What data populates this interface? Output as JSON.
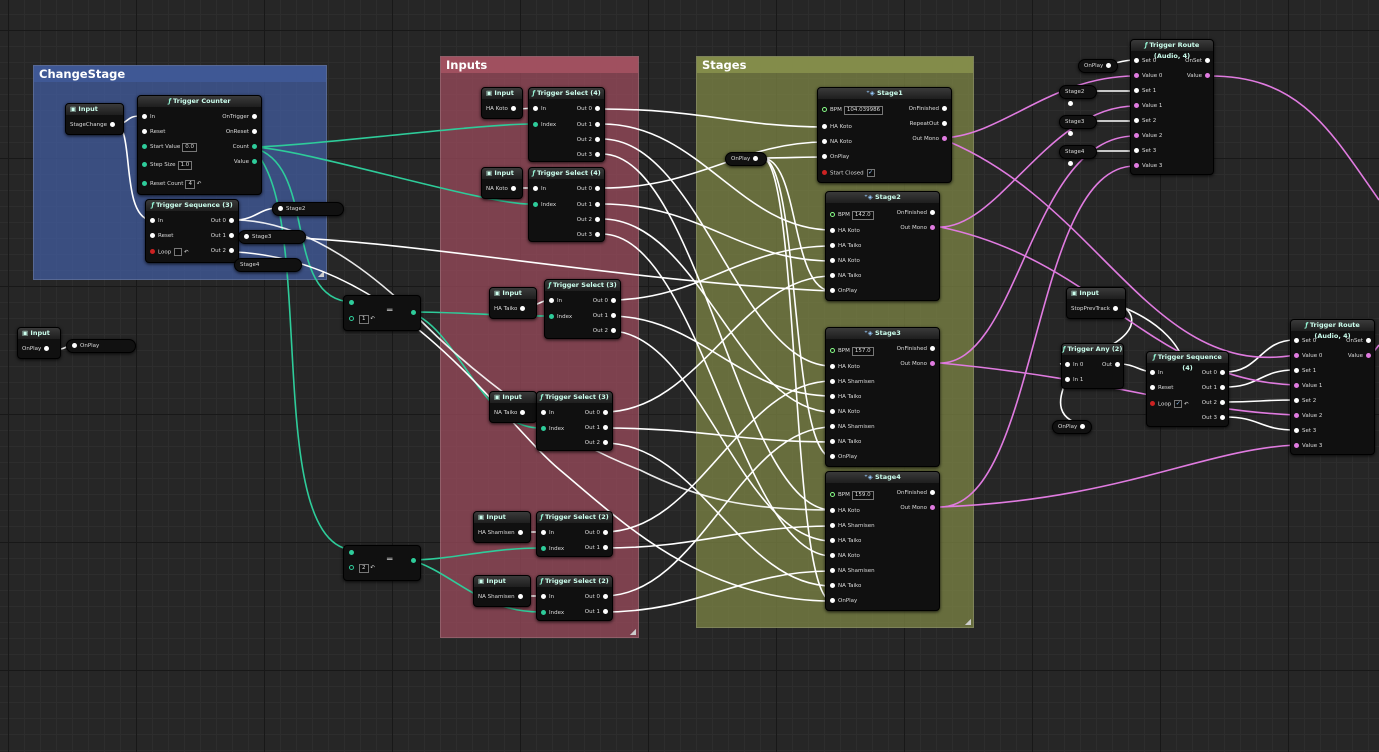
{
  "comments": {
    "change_stage": "ChangeStage",
    "inputs": "Inputs",
    "stages": "Stages"
  },
  "colors": {
    "blue_comment": "#3f5895",
    "red_comment": "#9b4b5c",
    "green_comment": "#7d8646",
    "wire_trigger": "#ffffff",
    "wire_int": "#2ecc9a",
    "wire_audio": "#e07be0"
  },
  "icons": {
    "function": "function-icon",
    "input": "input-icon",
    "stage": "stage-icon"
  },
  "change_stage": {
    "input_title": "Input",
    "input_pin": "StageChange",
    "counter": {
      "title": "Trigger Counter",
      "in": "In",
      "reset": "Reset",
      "start_value": "Start Value",
      "start_value_field": "0.0",
      "step_size": "Step Size",
      "step_size_field": "1.0",
      "reset_count": "Reset Count",
      "reset_count_field": "4",
      "on_trigger": "OnTrigger",
      "on_reset": "OnReset",
      "count": "Count",
      "value": "Value"
    },
    "sequence": {
      "title": "Trigger Sequence (3)",
      "in": "In",
      "reset": "Reset",
      "loop": "Loop",
      "out0": "Out 0",
      "out1": "Out 1",
      "out2": "Out 2"
    },
    "stage2": "Stage2",
    "stage3": "Stage3",
    "stage4": "Stage4"
  },
  "left_input": {
    "title": "Input",
    "pin": "OnPlay",
    "getter": "OnPlay"
  },
  "compare1": {
    "field": "1"
  },
  "compare2": {
    "field": "2"
  },
  "inputs": {
    "input_title": "Input",
    "ha_koto": "HA Koto",
    "na_koto": "NA Koto",
    "ha_taiko": "HA Taiko",
    "na_taiko": "NA Taiko",
    "ha_shamisen": "HA Shamisen",
    "na_shamisen": "NA Shamisen",
    "select4": "Trigger Select (4)",
    "select3": "Trigger Select (3)",
    "select2": "Trigger Select (2)",
    "in": "In",
    "index": "Index",
    "out0": "Out 0",
    "out1": "Out 1",
    "out2": "Out 2",
    "out3": "Out 3"
  },
  "stages": {
    "onplay_getter": "OnPlay",
    "stage1": {
      "title": "Stage1",
      "bpm_label": "BPM",
      "bpm": "104.039986",
      "pins": [
        "HA Koto",
        "NA Koto",
        "OnPlay",
        "Start Closed"
      ],
      "outs": [
        "OnFinished",
        "RepeatOut",
        "Out Mono"
      ]
    },
    "stage2": {
      "title": "Stage2",
      "bpm_label": "BPM",
      "bpm": "142.0",
      "pins": [
        "HA Koto",
        "HA Taiko",
        "NA Koto",
        "NA Taiko",
        "OnPlay"
      ],
      "outs": [
        "OnFinished",
        "Out Mono"
      ]
    },
    "stage3": {
      "title": "Stage3",
      "bpm_label": "BPM",
      "bpm": "157.0",
      "pins": [
        "HA Koto",
        "HA Shamisen",
        "HA Taiko",
        "NA Koto",
        "NA Shamisen",
        "NA Taiko",
        "OnPlay"
      ],
      "outs": [
        "OnFinished",
        "Out Mono"
      ]
    },
    "stage4": {
      "title": "Stage4",
      "bpm_label": "BPM",
      "bpm": "159.0",
      "pins": [
        "HA Koto",
        "HA Shamisen",
        "HA Taiko",
        "NA Koto",
        "NA Shamisen",
        "NA Taiko",
        "OnPlay"
      ],
      "outs": [
        "OnFinished",
        "Out Mono"
      ]
    }
  },
  "route_top": {
    "title": "Trigger Route (Audio, 4)",
    "onplay": "OnPlay",
    "stage2": "Stage2",
    "stage3": "Stage3",
    "stage4": "Stage4",
    "pins": [
      "Set 0",
      "Value 0",
      "Set 1",
      "Value 1",
      "Set 2",
      "Value 2",
      "Set 3",
      "Value 3"
    ],
    "on_set": "OnSet",
    "value": "Value"
  },
  "right_input": {
    "title": "Input",
    "pin": "StopPrevTrack"
  },
  "trigger_any": {
    "title": "Trigger Any (2)",
    "in0": "In 0",
    "in1": "In 1",
    "out": "Out"
  },
  "right_sequence": {
    "title": "Trigger Sequence (4)",
    "in": "In",
    "reset": "Reset",
    "loop": "Loop",
    "outs": [
      "Out 0",
      "Out 1",
      "Out 2",
      "Out 3"
    ]
  },
  "right_onplay": "OnPlay",
  "route_right": {
    "title": "Trigger Route (Audio, 4)",
    "pins": [
      "Set 0",
      "Value 0",
      "Set 1",
      "Value 1",
      "Set 2",
      "Value 2",
      "Set 3",
      "Value 3"
    ],
    "on_set": "OnSet",
    "value": "Value"
  }
}
